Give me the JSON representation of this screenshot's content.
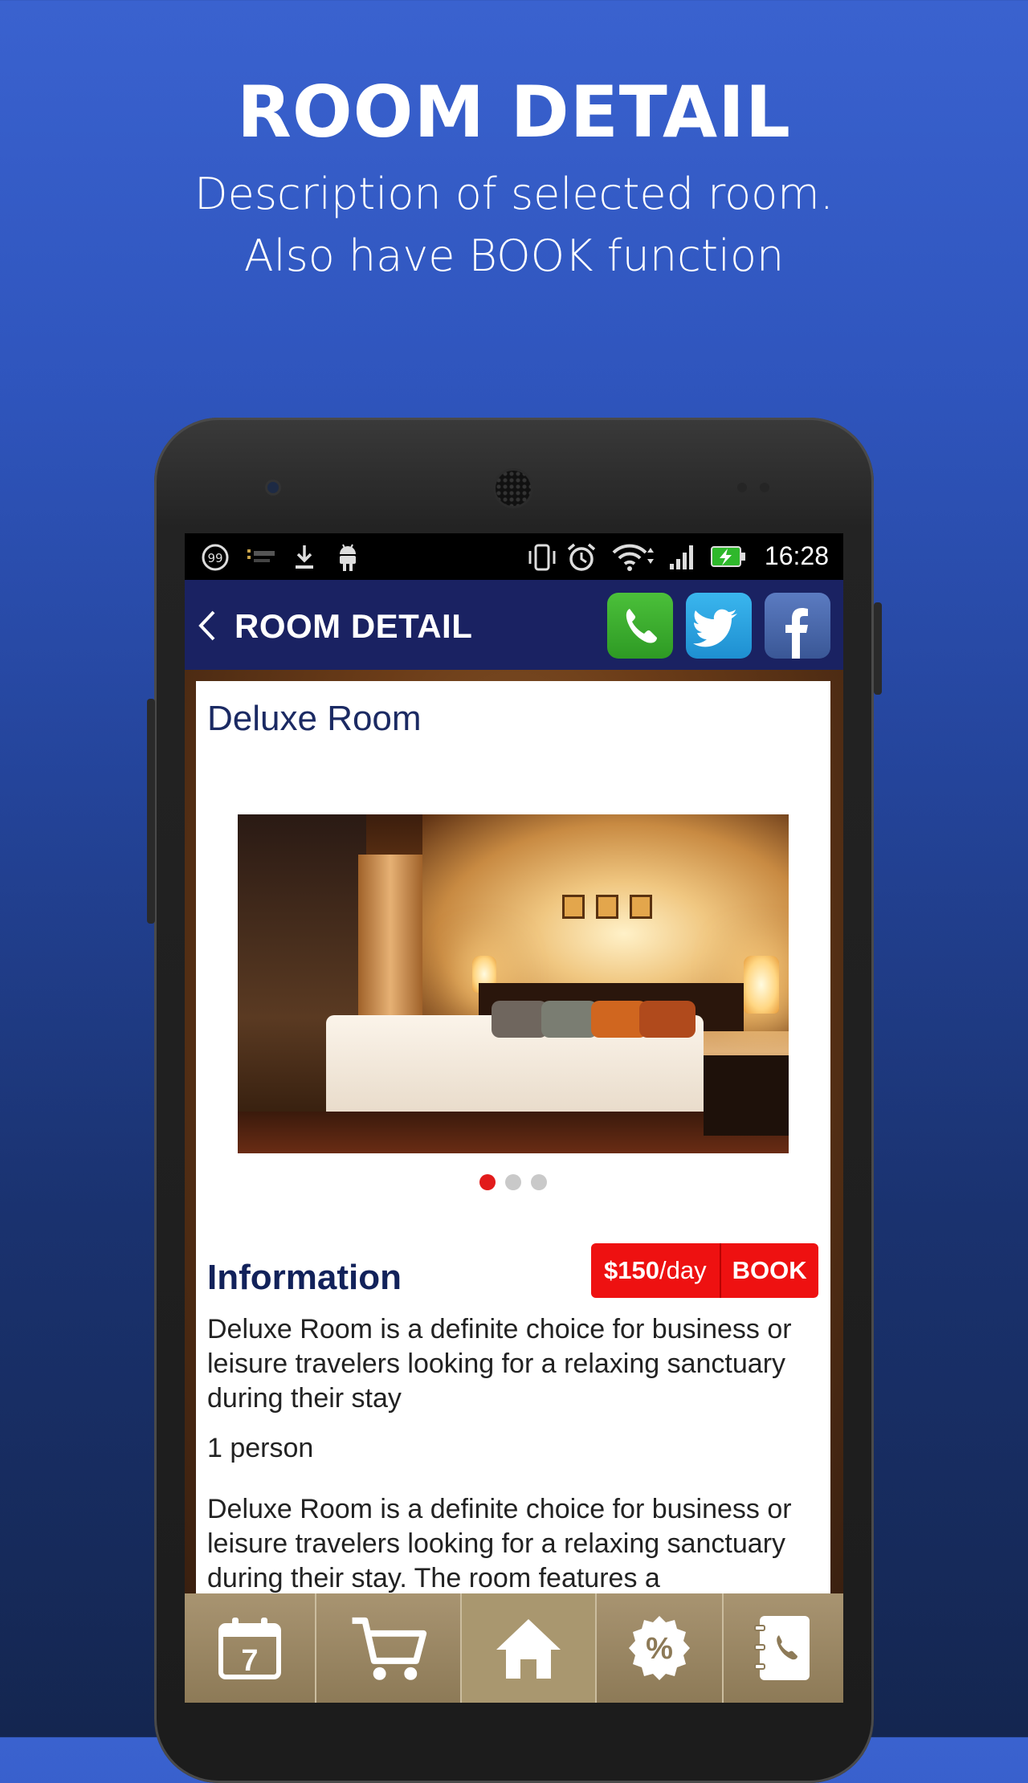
{
  "promo": {
    "title": "ROOM DETAIL",
    "subtitle_line1": "Description of selected room.",
    "subtitle_line2": "Also have BOOK function"
  },
  "status_bar": {
    "time": "16:28",
    "icons": [
      "notification-99-icon",
      "app-icon",
      "download-icon",
      "android-icon",
      "vibrate-icon",
      "alarm-icon",
      "wifi-icon",
      "signal-icon",
      "battery-charging-icon"
    ]
  },
  "app_bar": {
    "title": "ROOM DETAIL",
    "back_icon": "chevron-left-icon",
    "actions": [
      "phone-icon",
      "twitter-icon",
      "facebook-icon"
    ]
  },
  "room": {
    "name": "Deluxe Room",
    "gallery_dots": 3,
    "active_dot": 1,
    "info_heading": "Information",
    "price": "$150",
    "price_unit": "/day",
    "book_label": "BOOK",
    "description": "Deluxe Room is a definite choice for business or leisure travelers looking for a relaxing sanctuary during their stay",
    "capacity": "1 person",
    "long_description": "Deluxe Room is a definite choice for business or leisure travelers looking for a relaxing sanctuary during their stay. The room features a"
  },
  "bottom_nav": {
    "items": [
      "calendar-icon",
      "cart-icon",
      "home-icon",
      "discount-icon",
      "contact-book-icon"
    ],
    "calendar_day": "7",
    "discount_symbol": "%"
  },
  "colors": {
    "background_top": "#3a62cf",
    "app_bar": "#1a2262",
    "heading_navy": "#12225a",
    "book_red": "#ee1111",
    "active_dot": "#e21b1b",
    "nav_bar": "#a08c68"
  }
}
